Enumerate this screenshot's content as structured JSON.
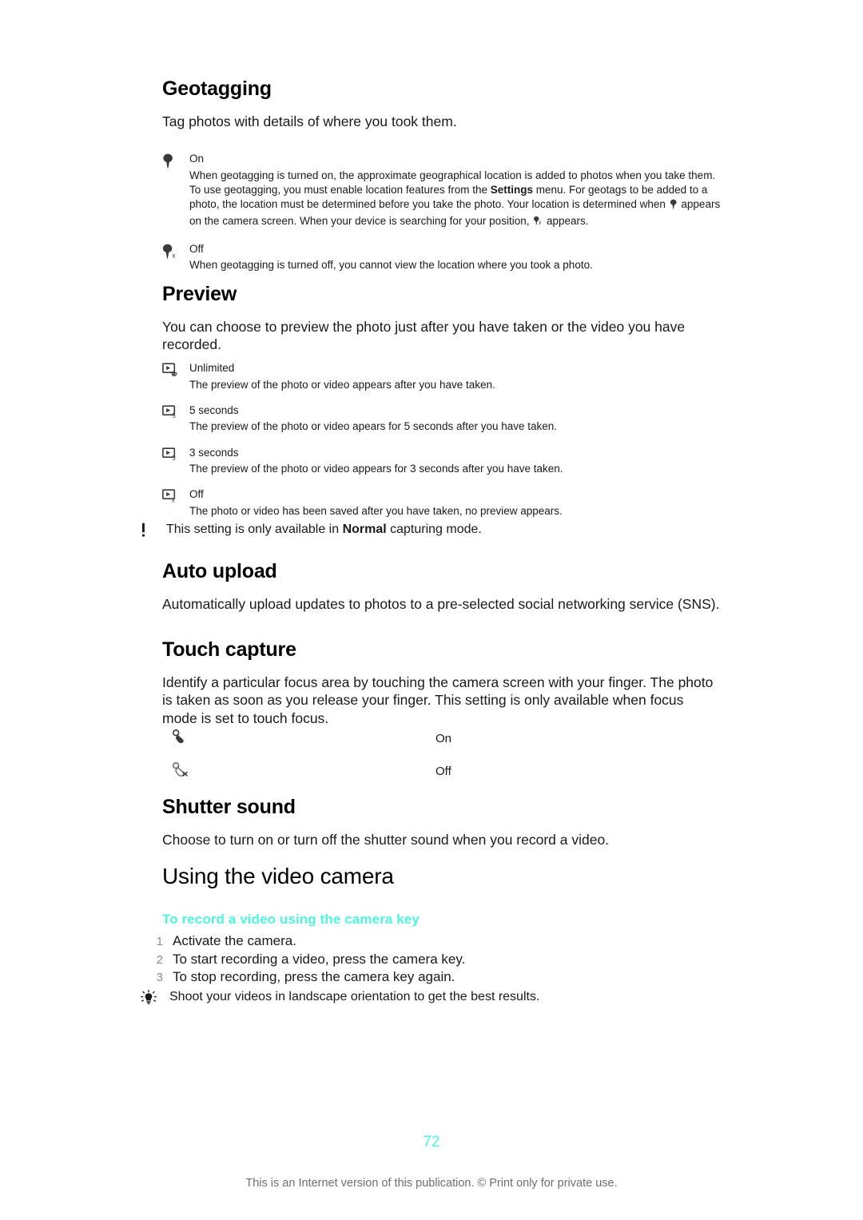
{
  "document": {
    "page_number": "72",
    "footer_note": "This is an Internet version of this publication. © Print only for private use.",
    "accent_color": "#4DF5DF"
  },
  "sections": {
    "geotagging": {
      "heading": "Geotagging",
      "intro": "Tag photos with details of where you took them.",
      "options": [
        {
          "icon": "location-pin-on-icon",
          "title": "On",
          "desc_part1": "When geotagging is turned on, the approximate geographical location is added to photos when you take them. To use geotagging, you must enable location features from the ",
          "desc_bold": "Settings",
          "desc_part2": " menu. For geotags to be added to a photo, the location must be determined before you take the photo. Your location is determined when ",
          "desc_part3": " appears on the camera screen. When your device is searching for your position, ",
          "desc_part4": " appears."
        },
        {
          "icon": "location-pin-off-icon",
          "title": "Off",
          "desc": "When geotagging is turned off, you cannot view the location where you took a photo."
        }
      ]
    },
    "preview": {
      "heading": "Preview",
      "intro": "You can choose to preview the photo just after you have taken or the video you have recorded.",
      "options": [
        {
          "icon": "preview-unlimited-icon",
          "title": "Unlimited",
          "desc": "The preview of the photo or video appears after you have taken."
        },
        {
          "icon": "preview-5-seconds-icon",
          "title": "5 seconds",
          "desc": "The preview of the photo or video apears for 5 seconds after you have taken."
        },
        {
          "icon": "preview-3-seconds-icon",
          "title": "3 seconds",
          "desc": "The preview of the photo or video appears for 3 seconds after you have taken."
        },
        {
          "icon": "preview-off-icon",
          "title": "Off",
          "desc": "The photo or video has been saved after you have taken, no preview appears."
        }
      ],
      "note_icon": "exclamation-note-icon",
      "note_part1": "This setting is only available in ",
      "note_bold": "Normal",
      "note_part2": " capturing mode."
    },
    "auto_upload": {
      "heading": "Auto upload",
      "body": "Automatically upload updates to photos to a pre-selected social networking service (SNS)."
    },
    "touch_capture": {
      "heading": "Touch capture",
      "body": "Identify a particular focus area by touching the camera screen with your finger. The photo is taken as soon as you release your finger. This setting is only available when focus mode is set to touch focus.",
      "rows": [
        {
          "icon": "touch-capture-on-icon",
          "label": "On"
        },
        {
          "icon": "touch-capture-off-icon",
          "label": "Off"
        }
      ]
    },
    "shutter_sound": {
      "heading": "Shutter sound",
      "body": "Choose to turn on or turn off the shutter sound when you record a video."
    },
    "using_video_camera": {
      "heading": "Using the video camera",
      "task_heading": "To record a video using the camera key",
      "steps": [
        {
          "num": "1",
          "text": "Activate the camera."
        },
        {
          "num": "2",
          "text": "To start recording a video, press the camera key."
        },
        {
          "num": "3",
          "text": "To stop recording, press the camera key again."
        }
      ],
      "tip_icon": "lightbulb-tip-icon",
      "tip": "Shoot your videos in landscape orientation to get the best results."
    }
  }
}
